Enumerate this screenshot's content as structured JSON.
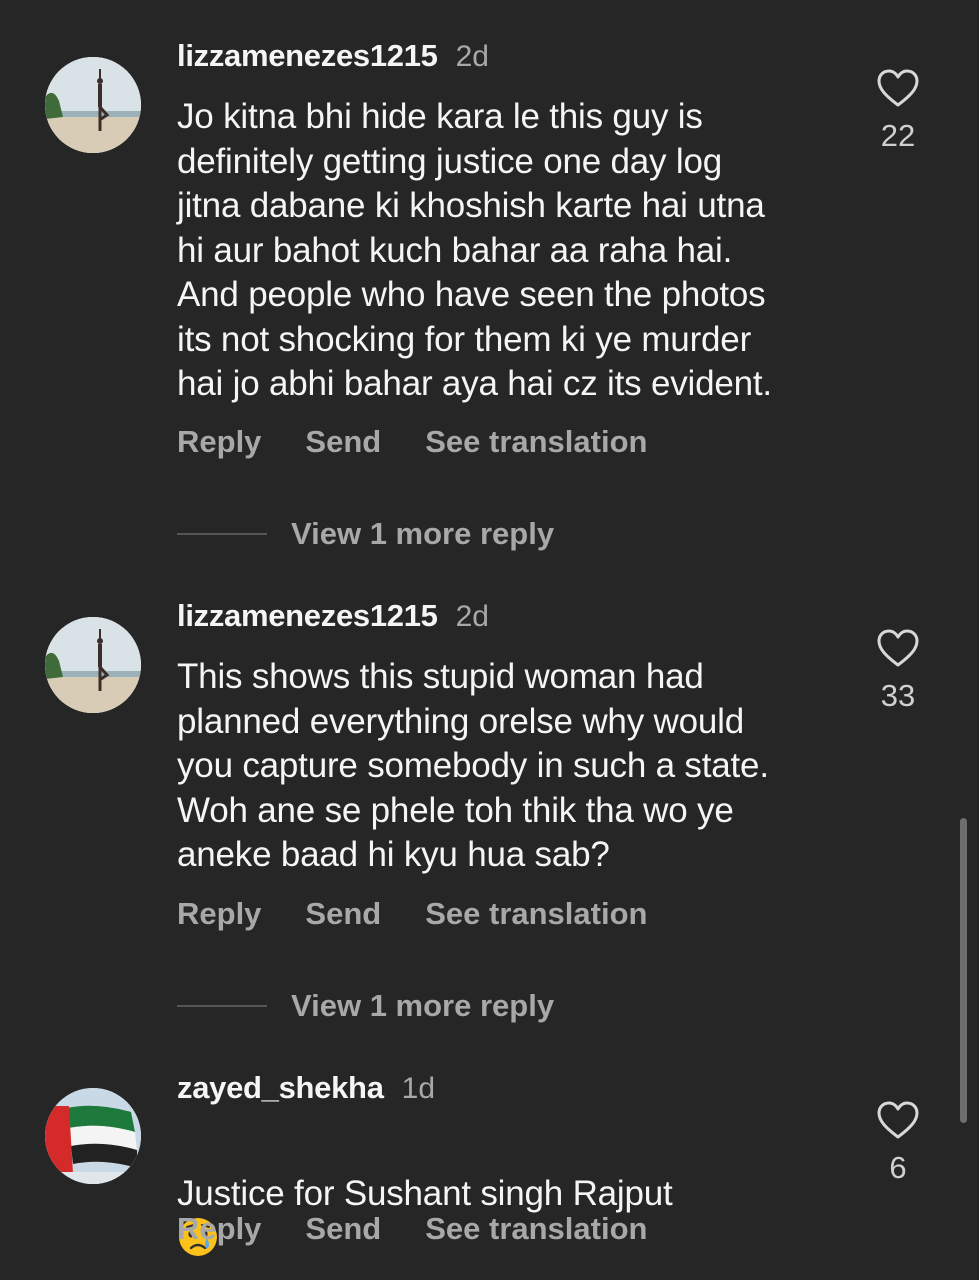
{
  "comments": [
    {
      "username": "lizzamenezes1215",
      "time": "2d",
      "text": "Jo kitna bhi hide kara le this guy is\ndefinitely getting justice one day log\njitna dabane ki khoshish karte hai utna\nhi aur bahot kuch bahar aa raha hai.\nAnd people who have seen the photos\nits not shocking for them ki ye murder\nhai jo abhi bahar aya hai cz its evident.",
      "likes": "22",
      "reply_label": "Reply",
      "send_label": "Send",
      "translate_label": "See translation",
      "view_more": "View 1 more reply"
    },
    {
      "username": "lizzamenezes1215",
      "time": "2d",
      "text": "This shows this stupid woman had\nplanned everything orelse why would\nyou capture somebody in such a state.\nWoh ane se phele toh thik tha wo ye\naneke baad hi kyu hua sab?",
      "likes": "33",
      "reply_label": "Reply",
      "send_label": "Send",
      "translate_label": "See translation",
      "view_more": "View 1 more reply"
    },
    {
      "username": "zayed_shekha",
      "time": "1d",
      "text": "Justice for Sushant singh Rajput",
      "emoji": "crying-face",
      "likes": "6",
      "reply_label": "Reply",
      "send_label": "Send",
      "translate_label": "See translation"
    }
  ],
  "colors": {
    "background": "#262626",
    "primary_text": "#f5f5f5",
    "secondary_text": "#a8a8a8"
  },
  "icons": {
    "like": "heart-outline-icon",
    "emoji": "crying-face-emoji"
  }
}
